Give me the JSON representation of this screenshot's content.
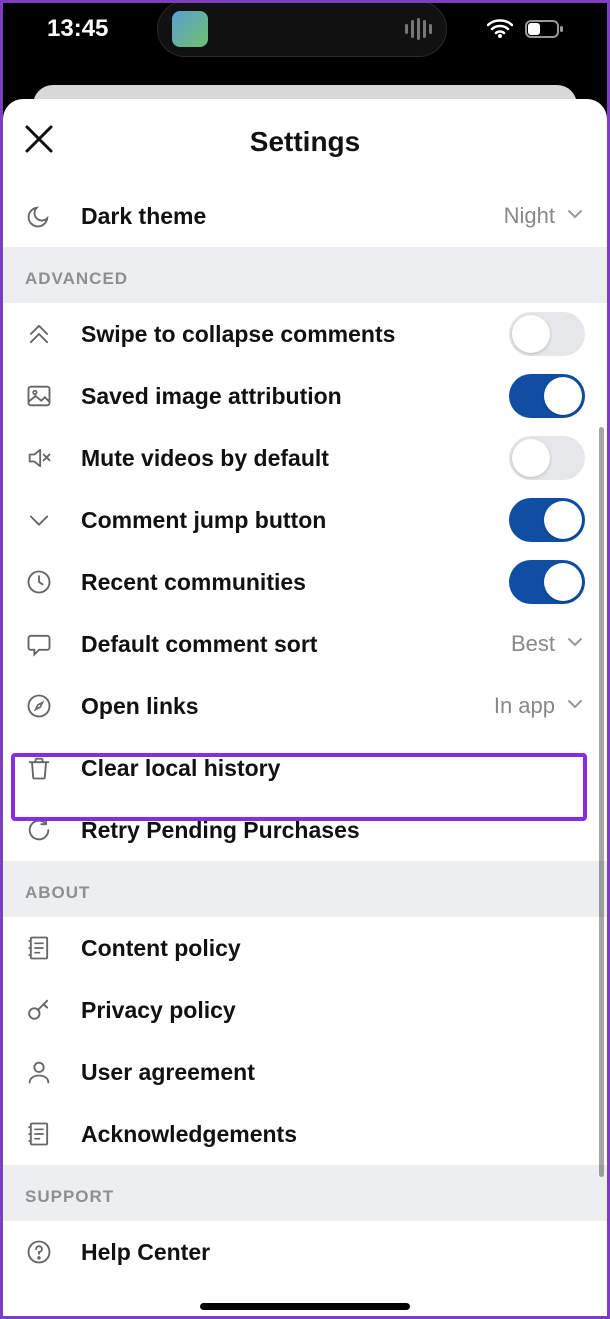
{
  "status": {
    "time": "13:45"
  },
  "header": {
    "title": "Settings"
  },
  "dark_theme": {
    "label": "Dark theme",
    "value": "Night"
  },
  "sections": {
    "advanced": "ADVANCED",
    "about": "ABOUT",
    "support": "SUPPORT"
  },
  "advanced": {
    "swipe_collapse": {
      "label": "Swipe to collapse comments",
      "on": false
    },
    "saved_attr": {
      "label": "Saved image attribution",
      "on": true
    },
    "mute_videos": {
      "label": "Mute videos by default",
      "on": false
    },
    "comment_jump": {
      "label": "Comment jump button",
      "on": true
    },
    "recent_communities": {
      "label": "Recent communities",
      "on": true
    },
    "default_sort": {
      "label": "Default comment sort",
      "value": "Best"
    },
    "open_links": {
      "label": "Open links",
      "value": "In app"
    },
    "clear_history": {
      "label": "Clear local history"
    },
    "retry_purchases": {
      "label": "Retry Pending Purchases"
    }
  },
  "about": {
    "content_policy": "Content policy",
    "privacy_policy": "Privacy policy",
    "user_agreement": "User agreement",
    "acknowledgements": "Acknowledgements"
  },
  "support": {
    "help_center": "Help Center"
  }
}
